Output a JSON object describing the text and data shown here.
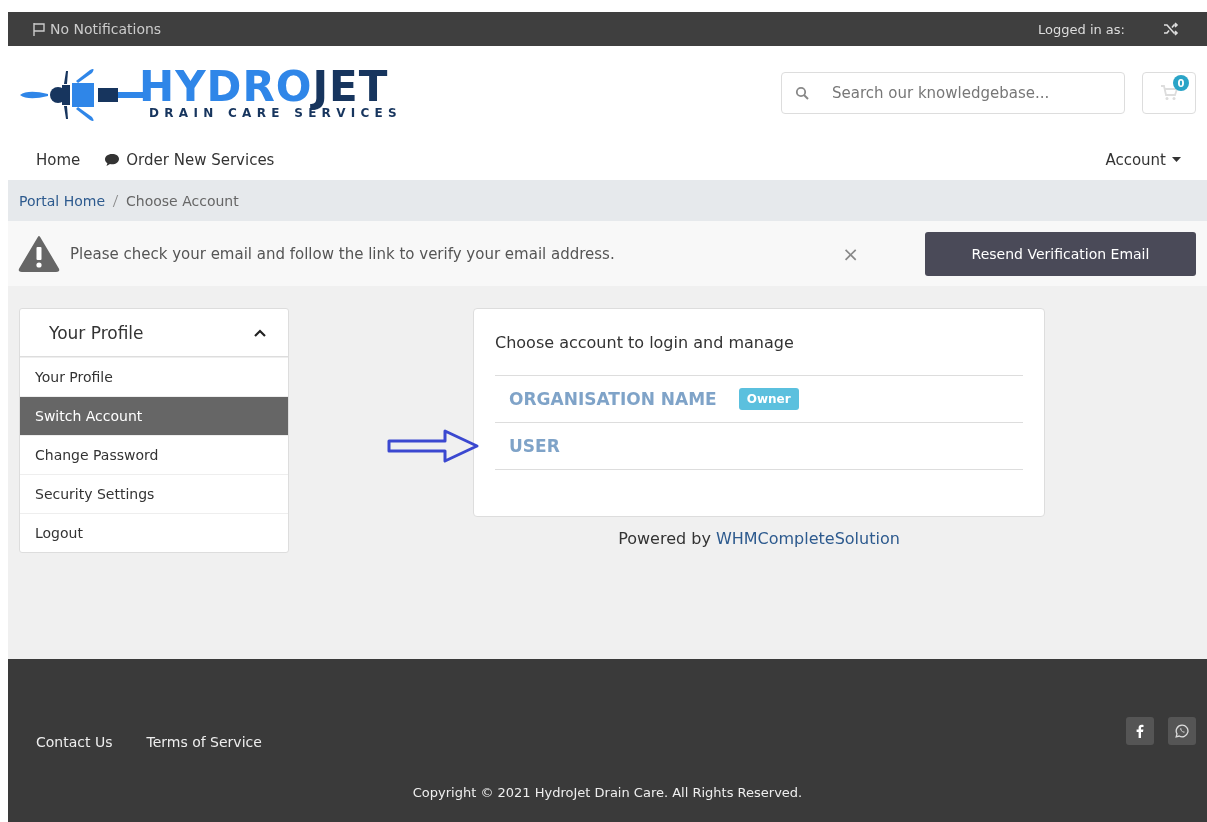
{
  "top_bar": {
    "notifications": "No Notifications",
    "logged_in": "Logged in as:"
  },
  "logo": {
    "word_light": "HYDRO",
    "word_dark": "JET",
    "tagline": "DRAIN CARE SERVICES"
  },
  "search": {
    "placeholder": "Search our knowledgebase..."
  },
  "cart": {
    "count": "0"
  },
  "nav": {
    "items": [
      {
        "label": "Home",
        "kind": "plain"
      },
      {
        "label": "Order New Services",
        "kind": "chat"
      }
    ],
    "account": "Account"
  },
  "breadcrumb": [
    {
      "label": "Portal Home",
      "kind": "link"
    },
    {
      "label": "Choose Account",
      "kind": "current"
    }
  ],
  "alert": {
    "message": "Please check your email and follow the link to verify your email address.",
    "close": "×",
    "button": "Resend Verification Email"
  },
  "sidebar": {
    "title": "Your Profile",
    "expanded": true,
    "items": [
      {
        "label": "Your Profile",
        "selected": false
      },
      {
        "label": "Switch Account",
        "selected": true
      },
      {
        "label": "Change Password",
        "selected": false
      },
      {
        "label": "Security Settings",
        "selected": false
      },
      {
        "label": "Logout",
        "selected": false
      }
    ]
  },
  "accounts": {
    "heading": "Choose account to login and manage",
    "items": [
      {
        "name": "ORGANISATION NAME",
        "badge": "Owner",
        "pointed": false
      },
      {
        "name": "USER",
        "pointed": true
      }
    ]
  },
  "powered": {
    "prefix": "Powered by",
    "link": "WHMCompleteSolution"
  },
  "footer": {
    "links": [
      "Contact Us",
      "Terms of Service"
    ],
    "copyright": "Copyright © 2021 HydroJet Drain Care. All Rights Reserved."
  }
}
